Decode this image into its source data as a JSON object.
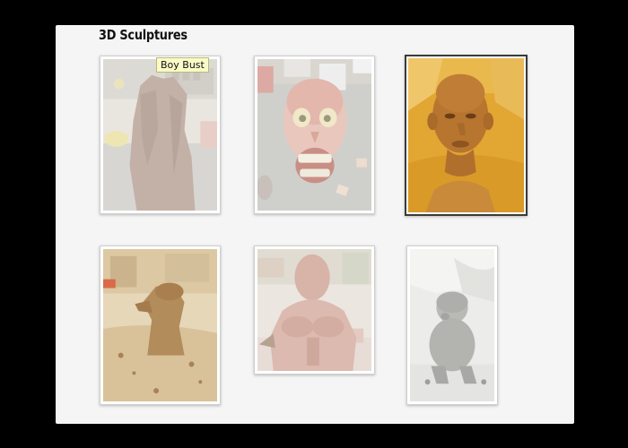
{
  "gallery": {
    "title": "3D Sculptures",
    "tooltip": "Boy Bust",
    "items": [
      {
        "name": "sculpture-thumbnail-tall-figure",
        "active": false
      },
      {
        "name": "sculpture-thumbnail-screaming-face",
        "active": false
      },
      {
        "name": "sculpture-thumbnail-boy-bust",
        "active": true
      },
      {
        "name": "sculpture-thumbnail-crouching-figure",
        "active": false
      },
      {
        "name": "sculpture-thumbnail-muscular-torso",
        "active": false
      },
      {
        "name": "sculpture-thumbnail-seated-child",
        "active": false
      }
    ]
  },
  "colors": {
    "page_background": "#000000",
    "panel_background": "#f5f5f5",
    "active_border": "#3a3a3a",
    "tooltip_background": "#fbfbc8"
  }
}
